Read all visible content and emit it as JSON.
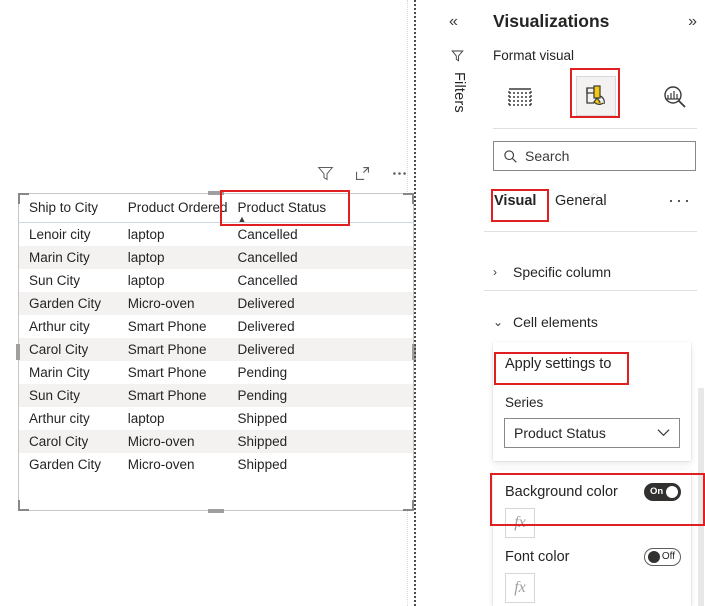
{
  "canvas": {
    "visual_toolbar": [
      {
        "name": "filter-icon",
        "label": "Filters"
      },
      {
        "name": "focus-mode-icon",
        "label": "Focus mode"
      },
      {
        "name": "more-options-icon",
        "label": "More options"
      }
    ],
    "table": {
      "columns": [
        "Ship to City",
        "Product Ordered",
        "Product Status"
      ],
      "sorted_column": "Product Status",
      "sort_direction": "ascending",
      "sort_glyph": "▲",
      "rows": [
        [
          "Lenoir city",
          "laptop",
          "Cancelled"
        ],
        [
          "Marin City",
          "laptop",
          "Cancelled"
        ],
        [
          "Sun City",
          "laptop",
          "Cancelled"
        ],
        [
          "Garden City",
          "Micro-oven",
          "Delivered"
        ],
        [
          "Arthur city",
          "Smart Phone",
          "Delivered"
        ],
        [
          "Carol City",
          "Smart Phone",
          "Delivered"
        ],
        [
          "Marin City",
          "Smart Phone",
          "Pending"
        ],
        [
          "Sun City",
          "Smart Phone",
          "Pending"
        ],
        [
          "Arthur city",
          "laptop",
          "Shipped"
        ],
        [
          "Carol City",
          "Micro-oven",
          "Shipped"
        ],
        [
          "Garden City",
          "Micro-oven",
          "Shipped"
        ]
      ]
    }
  },
  "filters_rail": {
    "collapse_glyph": "«",
    "label": "Filters"
  },
  "visualizations_pane": {
    "title": "Visualizations",
    "expand_glyph": "»",
    "subtitle": "Format visual",
    "format_tabs": [
      {
        "name": "build-visual-tab",
        "label": "Build visual",
        "selected": false
      },
      {
        "name": "format-visual-tab",
        "label": "Format visual",
        "selected": true
      },
      {
        "name": "analytics-tab",
        "label": "Analytics",
        "selected": false
      }
    ],
    "search": {
      "placeholder": "Search",
      "value": ""
    },
    "subtabs": {
      "visual": "Visual",
      "general": "General",
      "more": "···",
      "selected": "Visual"
    },
    "sections": [
      {
        "name": "specific-column",
        "label": "Specific column",
        "expanded": false,
        "chevron": "›"
      },
      {
        "name": "cell-elements",
        "label": "Cell elements",
        "expanded": true,
        "chevron": "⌄"
      }
    ],
    "apply_settings_card": {
      "title": "Apply settings to",
      "series_label": "Series",
      "series_value": "Product Status",
      "chevron": "⌄"
    },
    "color_card": {
      "background_color": {
        "label": "Background color",
        "toggle_state": "On",
        "fx_label": "fx"
      },
      "font_color": {
        "label": "Font color",
        "toggle_state": "Off",
        "fx_label": "fx"
      }
    }
  },
  "annotations": {
    "color": "#e02020",
    "boxes": [
      {
        "name": "annotation-product-status-column"
      },
      {
        "name": "annotation-format-visual-tab"
      },
      {
        "name": "annotation-visual-subtab"
      },
      {
        "name": "annotation-apply-settings-to"
      },
      {
        "name": "annotation-background-color"
      }
    ]
  }
}
